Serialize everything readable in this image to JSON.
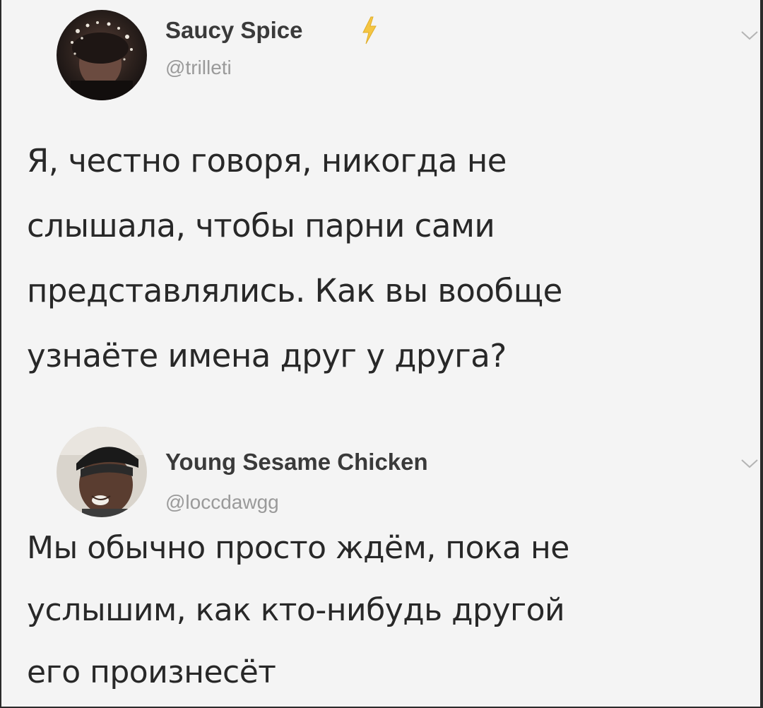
{
  "tweets": [
    {
      "user": {
        "display_name": "Saucy Spice",
        "handle": "@trilleti",
        "avatar_icon": "avatar-photo-dark",
        "badge_icon": "lightning-bolt-icon",
        "badge_color": "#f5c542"
      },
      "text_lines": [
        "Я, честно говоря, никогда не",
        "слышала, чтобы парни сами",
        "представлялись. Как вы вообще",
        "узнаёте имена друг у друга?"
      ],
      "menu_icon": "chevron-down-icon"
    },
    {
      "user": {
        "display_name": "Young Sesame Chicken",
        "handle": "@loccdawgg",
        "avatar_icon": "avatar-photo-man-cap"
      },
      "text_lines": [
        "Мы обычно просто ждём, пока не",
        "услышим, как кто-нибудь другой",
        "его произнесёт"
      ],
      "menu_icon": "chevron-down-icon"
    }
  ],
  "colors": {
    "background": "#f4f4f4",
    "frame": "#2b2b2b",
    "name_text": "#3a3a3a",
    "handle_text": "#9a9a9a",
    "body_text": "#282828"
  }
}
